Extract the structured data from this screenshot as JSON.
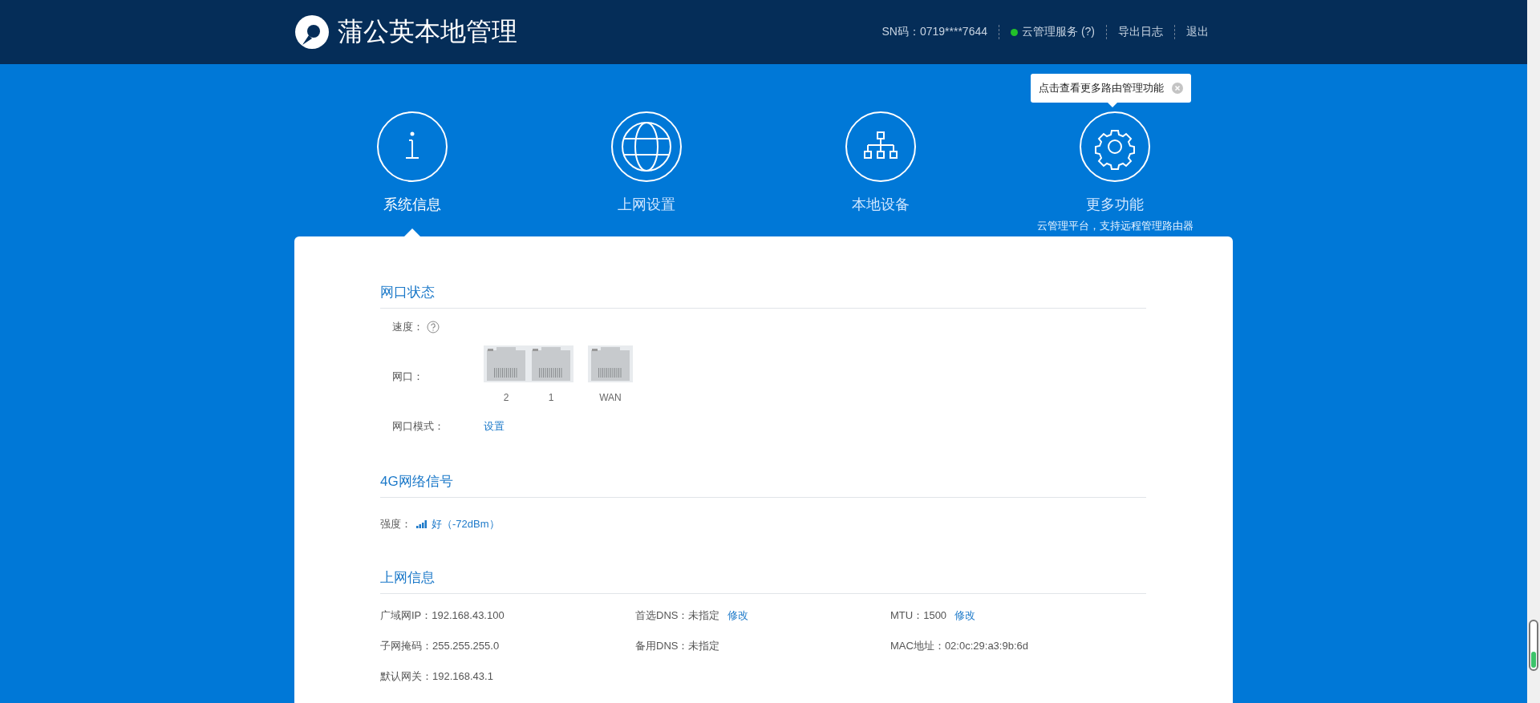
{
  "header": {
    "title": "蒲公英本地管理",
    "sn": "SN码：0719****7644",
    "cloud_service": {
      "label": "云管理服务 (?)",
      "color": "#22c02a"
    },
    "links": [
      "导出日志",
      "退出"
    ]
  },
  "tooltip": {
    "text": "点击查看更多路由管理功能"
  },
  "nav": [
    {
      "kind": "info",
      "label": "系统信息",
      "selected": true
    },
    {
      "kind": "globe",
      "label": "上网设置",
      "selected": false
    },
    {
      "kind": "network",
      "label": "本地设备",
      "selected": false
    },
    {
      "kind": "gear",
      "label": "更多功能",
      "subtitle": "云管理平台，支持远程管理路由器",
      "selected": false
    }
  ],
  "port_status": {
    "title": "网口状态",
    "speed_label": "速度：",
    "ports_label": "网口：",
    "ports": [
      {
        "label": "2",
        "connected": false
      },
      {
        "label": "1",
        "connected": false
      },
      {
        "label": "WAN",
        "connected": false
      }
    ],
    "mode_label": "网口模式：",
    "mode_link": "设置"
  },
  "signal": {
    "title": "4G网络信号",
    "label": "强度：",
    "value": "好（-72dBm）"
  },
  "internet": {
    "title": "上网信息",
    "rows": [
      [
        {
          "label": "广域网IP：",
          "value": "192.168.43.100"
        },
        {
          "label": "首选DNS：",
          "value": "未指定",
          "link": "修改"
        },
        {
          "label": "MTU：",
          "value": "1500",
          "link": "修改"
        }
      ],
      [
        {
          "label": "子网掩码：",
          "value": "255.255.255.0"
        },
        {
          "label": "备用DNS：",
          "value": "未指定"
        },
        {
          "label": "MAC地址：",
          "value": "02:0c:29:a3:9b:6d"
        }
      ],
      [
        {
          "label": "默认网关：",
          "value": "192.168.43.1"
        }
      ]
    ]
  }
}
